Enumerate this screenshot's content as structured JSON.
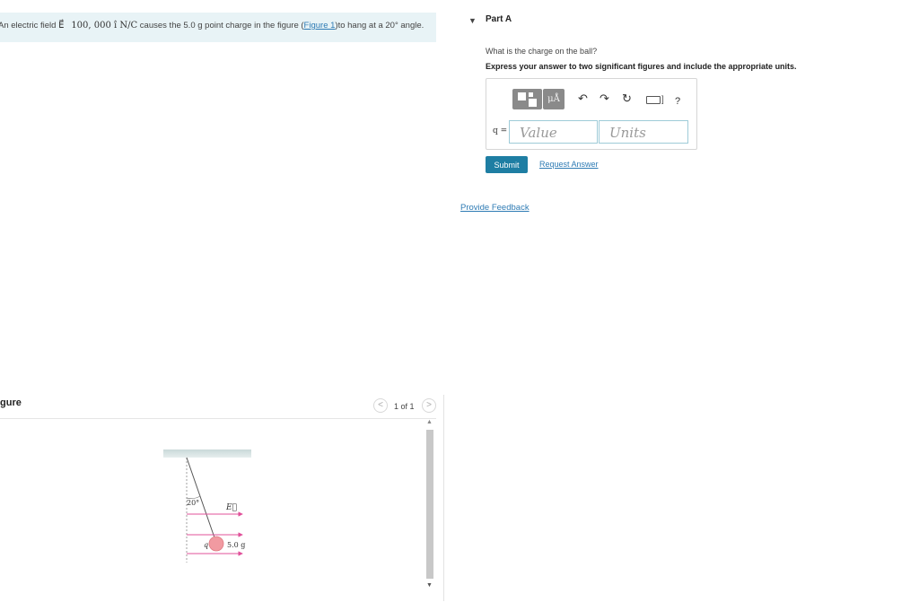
{
  "problem": {
    "pre": "An electric field ",
    "field_symbol": "E⃗",
    "field_value": "100, 000 î N/C",
    "mid": " causes the 5.0 g point charge in the figure (",
    "link": "Figure 1",
    "post": ")to hang at a 20° angle."
  },
  "figure_panel": {
    "header": "gure",
    "prev": "<",
    "next": ">",
    "count": "1 of 1",
    "scroll_up": "▲",
    "scroll_down": "▼"
  },
  "figure": {
    "angle_label": "20°",
    "field_label": "E⃗",
    "charge_label": "q",
    "mass_label": "5.0 g",
    "colors": {
      "ceiling": "#c4d6d6",
      "field_arrow": "#e0509a",
      "ball": "#f19aa1",
      "string": "#555555"
    }
  },
  "part": {
    "caret": "▼",
    "title": "Part A",
    "question": "What is the charge on the ball?",
    "instruction": "Express your answer to two significant figures and include the appropriate units."
  },
  "answer": {
    "units_button": "μÅ",
    "undo": "↶",
    "redo": "↷",
    "reset": "↻",
    "kbd_bracket": "]",
    "help": "?",
    "label": "q =",
    "value_placeholder": "Value",
    "units_placeholder": "Units"
  },
  "actions": {
    "submit": "Submit",
    "request_answer": "Request Answer",
    "feedback": "Provide Feedback"
  },
  "colors": {
    "accent": "#1e7ea3",
    "link": "#2e7bb4",
    "problem_bg": "#e8f3f6"
  }
}
